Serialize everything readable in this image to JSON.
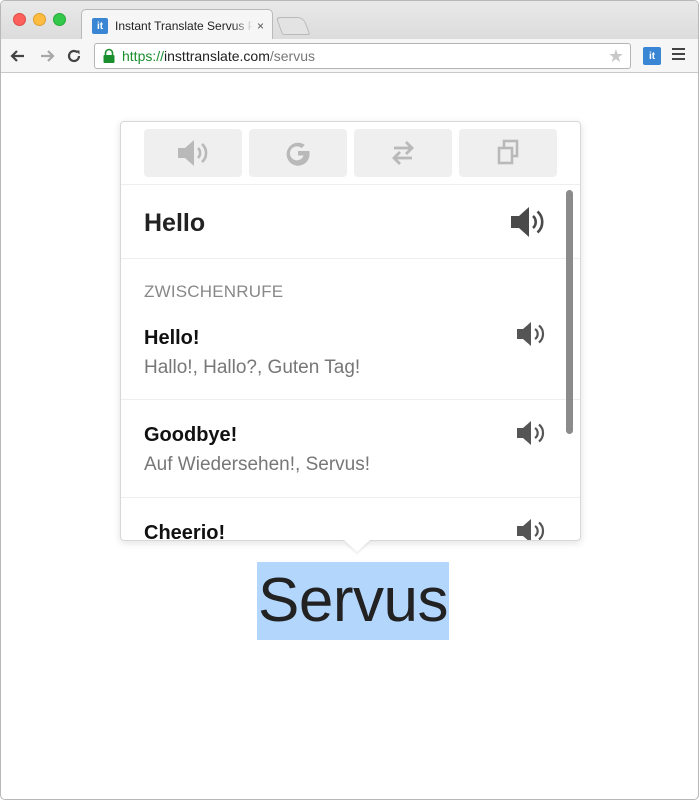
{
  "browser": {
    "tab_title": "Instant Translate Servus P",
    "tab_close": "×",
    "favicon_text": "it",
    "url_scheme": "https://",
    "url_host": "insttranslate.com",
    "url_path": "/servus",
    "extension_text": "it",
    "star": "★"
  },
  "popup": {
    "toolbar": [
      {
        "name": "speak",
        "icon": "speaker-icon"
      },
      {
        "name": "google",
        "icon": "google-g-icon"
      },
      {
        "name": "swap",
        "icon": "swap-arrows-icon"
      },
      {
        "name": "copy",
        "icon": "copy-icon"
      }
    ],
    "headword": "Hello",
    "section_label": "ZWISCHENRUFE",
    "entries": [
      {
        "word": "Hello!",
        "translation": "Hallo!, Hallo?, Guten Tag!"
      },
      {
        "word": "Goodbye!",
        "translation": "Auf Wiedersehen!, Servus!"
      },
      {
        "word": "Cheerio!",
        "translation": ""
      }
    ]
  },
  "page": {
    "selected_word": "Servus"
  },
  "colors": {
    "selection": "#b3d6fd",
    "accent": "#3a86d4",
    "secure_green": "#1a8f2d"
  }
}
